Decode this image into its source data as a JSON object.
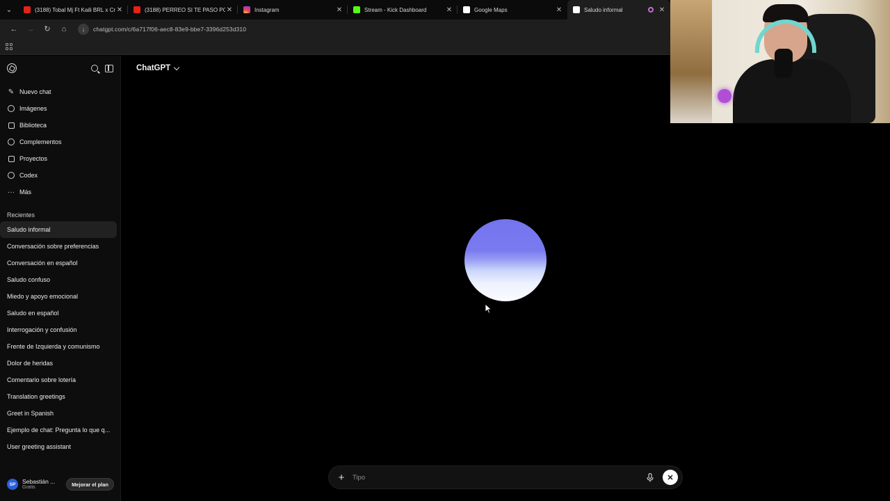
{
  "browser": {
    "tabs": [
      {
        "title": "(3188) Tobal Mj Ft Kaili BRL x Cr",
        "favicon": "youtube-icon"
      },
      {
        "title": "(3188) PERREO SI TE PASO POR",
        "favicon": "youtube-icon"
      },
      {
        "title": "Instagram",
        "favicon": "instagram-icon"
      },
      {
        "title": "Stream - Kick Dashboard",
        "favicon": "kick-icon"
      },
      {
        "title": "Google Maps",
        "favicon": "maps-icon"
      },
      {
        "title": "Saludo informal",
        "favicon": "chatgpt-icon",
        "active": true
      }
    ],
    "url": "chatgpt.com/c/6a717f06-aec8-83e9-bbe7-3396d253d310"
  },
  "sidebar": {
    "nav": [
      {
        "label": "Nuevo chat",
        "icon": "edit-icon"
      },
      {
        "label": "Imágenes",
        "icon": "image-icon"
      },
      {
        "label": "Biblioteca",
        "icon": "library-icon"
      },
      {
        "label": "Complementos",
        "icon": "apps-icon"
      },
      {
        "label": "Proyectos",
        "icon": "folder-icon"
      },
      {
        "label": "Codex",
        "icon": "codex-icon"
      },
      {
        "label": "Más",
        "icon": "more-icon"
      }
    ],
    "recents_label": "Recientes",
    "chats": [
      "Saludo informal",
      "Conversación sobre preferencias",
      "Conversación en español",
      "Saludo confuso",
      "Miedo y apoyo emocional",
      "Saludo en español",
      "Interrogación y confusión",
      "Frente de Izquierda y comunismo",
      "Dolor de heridas",
      "Comentario sobre lotería",
      "Translation greetings",
      "Greet in Spanish",
      "Ejemplo de chat: Pregunta lo que q...",
      "User greeting assistant"
    ],
    "user": {
      "initials": "SP",
      "name": "Sebastián ...",
      "plan": "Gratis"
    },
    "upgrade_label": "Mejorar el plan"
  },
  "main": {
    "model_label": "ChatGPT",
    "composer_placeholder": "Tipo"
  },
  "colors": {
    "accent_orb": "#7474ee",
    "background": "#000000",
    "avatar": "#2b5fd9"
  }
}
